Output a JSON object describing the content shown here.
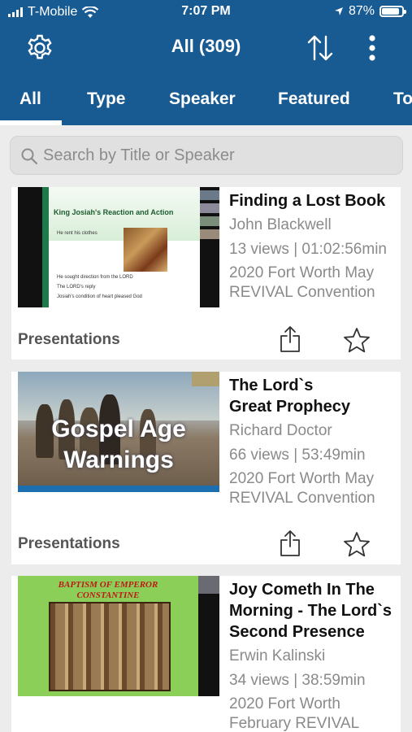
{
  "status_bar": {
    "carrier": "T-Mobile",
    "time": "7:07 PM",
    "battery_percent": "87%",
    "battery_level": 0.87
  },
  "header": {
    "title": "All (309)",
    "icons": [
      "gear-icon",
      "sort-icon",
      "more-vertical-icon"
    ]
  },
  "tabs": [
    "All",
    "Type",
    "Speaker",
    "Featured",
    "To"
  ],
  "active_tab": "All",
  "search": {
    "placeholder": "Search by Title or Speaker"
  },
  "items": [
    {
      "title": "Finding a Lost Book",
      "speaker": "John Blackwell",
      "views": "13 views | 01:02:56min",
      "event": "2020 Fort Worth May REVIVAL Convention",
      "category": "Presentations",
      "thumbnail": {
        "heading": "King Josiah's Reaction and Action",
        "bullets": [
          "He rent his clothes",
          "He sought direction from the LORD",
          "The LORD's reply",
          "Josiah's condition of heart pleased God"
        ]
      }
    },
    {
      "title": "The Lord`s Great Prophecy",
      "speaker": "Richard Doctor",
      "views": "66 views | 53:49min",
      "event": "2020 Fort Worth May REVIVAL Convention",
      "category": "Presentations",
      "thumbnail": {
        "line1": "Gospel Age",
        "line2": "Warnings"
      }
    },
    {
      "title": "Joy Cometh In The Morning - The Lord`s Second Presence",
      "speaker": "Erwin Kalinski",
      "views": "34 views | 38:59min",
      "event": "2020 Fort Worth February REVIVAL",
      "thumbnail": {
        "line1": "BAPTISM OF EMPEROR",
        "line2": "CONSTANTINE"
      }
    }
  ],
  "colors": {
    "header_blue": "#185a92",
    "background": "#ececec",
    "card": "#ffffff",
    "muted_text": "#8a8a8a"
  }
}
